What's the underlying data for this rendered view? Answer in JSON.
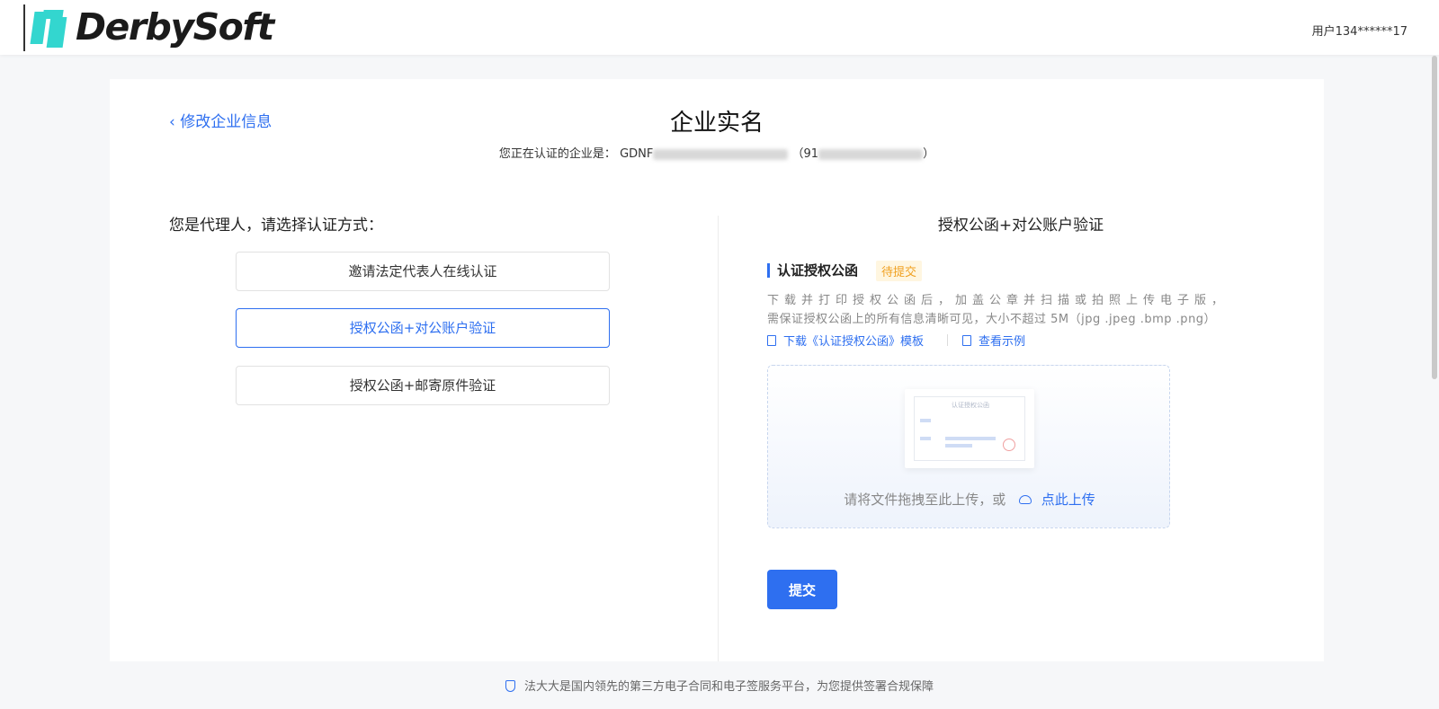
{
  "header": {
    "logo_text": "DerbySoft",
    "user_label": "用户134******17"
  },
  "page": {
    "back_link": "修改企业信息",
    "title": "企业实名",
    "subtitle_prefix": "您正在认证的企业是：",
    "company_name_visible": "GDNF",
    "credit_code_visible": "91"
  },
  "left": {
    "heading": "您是代理人，请选择认证方式：",
    "methods": [
      {
        "label": "邀请法定代表人在线认证",
        "active": false
      },
      {
        "label": "授权公函+对公账户验证",
        "active": true
      },
      {
        "label": "授权公函+邮寄原件验证",
        "active": false
      }
    ]
  },
  "right": {
    "heading": "授权公函+对公账户验证",
    "section_title": "认证授权公函",
    "status": "待提交",
    "desc_line1": "下载并打印授权公函后，加盖公章并扫描或拍照上传电子版，",
    "desc_line2": "需保证授权公函上的所有信息清晰可见，大小不超过 5M（jpg .jpeg .bmp .png）",
    "download_link": "下载《认证授权公函》模板",
    "example_link": "查看示例",
    "thumb_title": "认证授权公函",
    "drop_text": "请将文件拖拽至此上传，或",
    "upload_link": "点此上传",
    "submit": "提交"
  },
  "footer": {
    "text": "法大大是国内领先的第三方电子合同和电子签服务平台，为您提供签署合规保障"
  },
  "colors": {
    "accent": "#2e6ff0",
    "logo": "#33d6cf",
    "status": "#f0a020"
  }
}
